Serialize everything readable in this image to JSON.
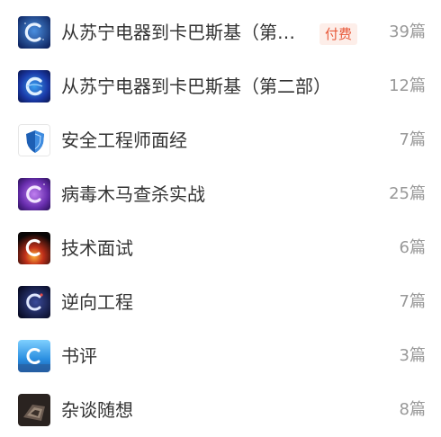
{
  "columns": [
    {
      "title": "从苏宁电器到卡巴斯基（第…",
      "badge": "付费",
      "count": "39篇",
      "icon": "galaxy-c-logo-icon"
    },
    {
      "title": "从苏宁电器到卡巴斯基（第二部）",
      "count": "12篇",
      "icon": "galaxy-c-logo-icon"
    },
    {
      "title": "安全工程师面经",
      "count": "7篇",
      "icon": "shield-icon"
    },
    {
      "title": "病毒木马查杀实战",
      "count": "25篇",
      "icon": "purple-galaxy-c-icon"
    },
    {
      "title": "技术面试",
      "count": "6篇",
      "icon": "fire-c-icon"
    },
    {
      "title": "逆向工程",
      "count": "7篇",
      "icon": "night-c-icon"
    },
    {
      "title": "书评",
      "count": "3篇",
      "icon": "sky-c-icon"
    },
    {
      "title": "杂谈随想",
      "count": "8篇",
      "icon": "dark-photo-icon"
    }
  ],
  "colors": {
    "title": "#333333",
    "count": "#999999",
    "badge_text": "#e8593a",
    "badge_bg": "#fdeee9"
  }
}
